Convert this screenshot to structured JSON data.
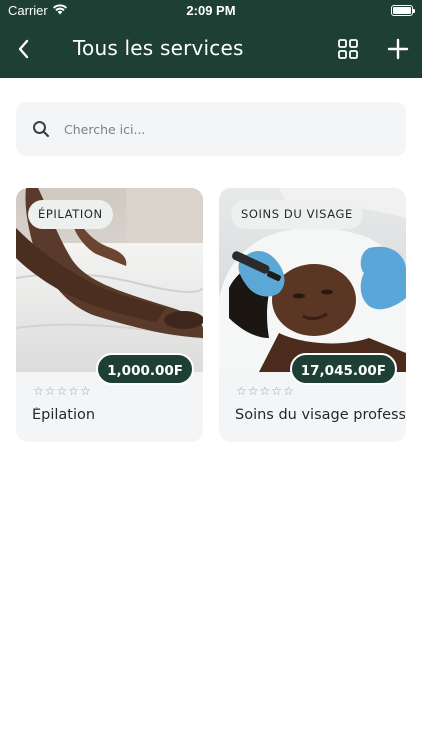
{
  "status_bar": {
    "carrier": "Carrier",
    "time": "2:09 PM"
  },
  "header": {
    "title": "Tous les services",
    "back_icon": "chevron-left-icon",
    "grid_icon": "grid-view-icon",
    "add_icon": "plus-icon",
    "background_color": "#1e4034"
  },
  "search": {
    "placeholder": "Cherche ici...",
    "value": "",
    "icon": "search-icon"
  },
  "services": [
    {
      "category": "ÉPILATION",
      "price": "1,000.00F",
      "stars": "☆☆☆☆☆",
      "rating": 0,
      "name": "Épilation",
      "image": "legs-on-bed-photo"
    },
    {
      "category": "SOINS DU VISAGE",
      "price": "17,045.00F",
      "stars": "☆☆☆☆☆",
      "rating": 0,
      "name": "Soins du visage profess",
      "image": "facial-treatment-photo"
    }
  ],
  "colors": {
    "accent": "#1e4034",
    "card_bg": "#f4f5f7",
    "badge_bg": "#eef0ee"
  }
}
